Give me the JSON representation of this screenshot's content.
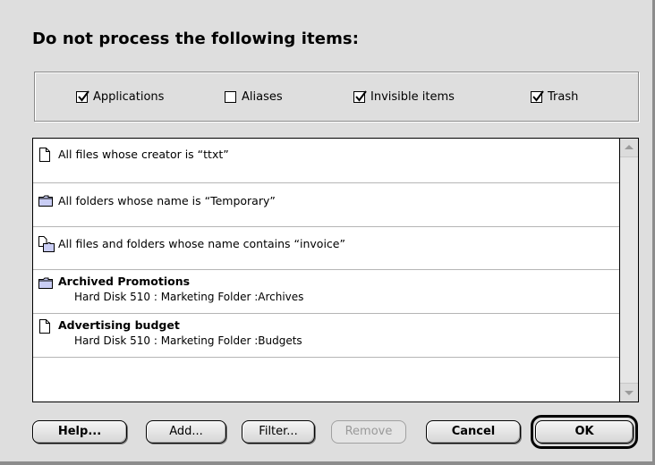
{
  "dialog": {
    "title": "Do not process the following items:"
  },
  "filters": [
    {
      "label": "Applications",
      "checked": true
    },
    {
      "label": "Aliases",
      "checked": false
    },
    {
      "label": "Invisible items",
      "checked": true
    },
    {
      "label": "Trash",
      "checked": true
    }
  ],
  "list": {
    "items": [
      {
        "icon": "document-icon",
        "text": "All files whose  creator is “ttxt”"
      },
      {
        "icon": "folder-icon",
        "text": "All folders whose name is “Temporary”"
      },
      {
        "icon": "file-and-folder-icon",
        "text": "All files and folders whose name contains “invoice”"
      },
      {
        "icon": "folder-icon",
        "name": "Archived Promotions",
        "path": "Hard Disk 510 : Marketing Folder :Archives"
      },
      {
        "icon": "document-icon",
        "name": "Advertising budget",
        "path": "Hard Disk 510 : Marketing Folder :Budgets"
      }
    ]
  },
  "buttons": {
    "help": "Help...",
    "add": "Add...",
    "filter": "Filter...",
    "remove": "Remove",
    "cancel": "Cancel",
    "ok": "OK"
  },
  "colors": {
    "dialog_bg": "#dedede",
    "folder_fill": "#c9cdf4",
    "disabled_text": "#9a9a9a"
  }
}
